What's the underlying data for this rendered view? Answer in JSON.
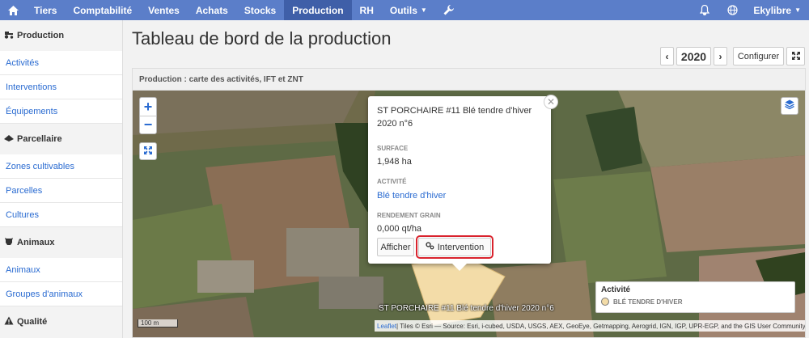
{
  "navbar": {
    "items": [
      "Tiers",
      "Comptabilité",
      "Ventes",
      "Achats",
      "Stocks",
      "Production",
      "RH",
      "Outils"
    ],
    "active": "Production",
    "user": "Ekylibre"
  },
  "sidebar": {
    "sections": [
      {
        "title": "Production",
        "links": [
          "Activités",
          "Interventions",
          "Équipements"
        ]
      },
      {
        "title": "Parcellaire",
        "links": [
          "Zones cultivables",
          "Parcelles",
          "Cultures"
        ]
      },
      {
        "title": "Animaux",
        "links": [
          "Animaux",
          "Groupes d'animaux"
        ]
      },
      {
        "title": "Qualité",
        "links": []
      }
    ]
  },
  "header": {
    "title": "Tableau de bord de la production",
    "year": "2020",
    "configure_label": "Configurer"
  },
  "card": {
    "title": "Production : carte des activités, IFT et ZNT"
  },
  "popup": {
    "title": "ST PORCHAIRE #11 Blé tendre d'hiver 2020 n°6",
    "surface_label": "SURFACE",
    "surface_value": "1,948 ha",
    "activity_label": "ACTIVITÉ",
    "activity_value": "Blé tendre d'hiver",
    "yield_label": "RENDEMENT GRAIN",
    "yield_value": "0,000 qt/ha",
    "show_label": "Afficher",
    "intervention_label": "Intervention"
  },
  "legend": {
    "title": "Activité",
    "entry": "BLÉ TENDRE D'HIVER",
    "swatch_color": "#f3dca8"
  },
  "map": {
    "plot_label": "ST PORCHAIRE #11 Blé tendre d'hiver 2020 n°6",
    "scale": "100 m",
    "attribution_link": "Leaflet",
    "attribution": " | Tiles © Esri — Source: Esri, i-cubed, USDA, USGS, AEX, GeoEye, Getmapping, Aerogrid, IGN, IGP, UPR-EGP, and the GIS User Community"
  },
  "colors": {
    "navbar": "#5b7ec9",
    "navbar_active": "#3f5fa8",
    "link": "#2a6bd1",
    "highlight": "#d9232d"
  }
}
